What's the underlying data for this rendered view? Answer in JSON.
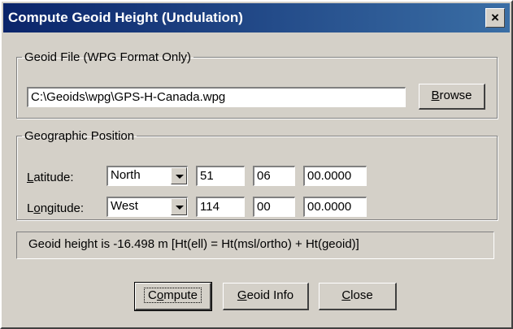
{
  "window": {
    "title": "Compute Geoid Height (Undulation)",
    "close_label": "×"
  },
  "geoid_file": {
    "legend": "Geoid File (WPG Format Only)",
    "path": "C:\\Geoids\\wpg\\GPS-H-Canada.wpg",
    "browse_rest": "rowse",
    "browse_accel": "B"
  },
  "geographic_position": {
    "legend": "Geographic Position",
    "latitude": {
      "label_accel": "L",
      "label_rest": "atitude:",
      "hemisphere": "North",
      "deg": "51",
      "min": "06",
      "sec": "00.0000"
    },
    "longitude": {
      "label_pre": "L",
      "label_accel": "o",
      "label_rest": "ngitude:",
      "hemisphere": "West",
      "deg": "114",
      "min": "00",
      "sec": "00.0000"
    }
  },
  "status_text": "Geoid height is -16.498 m  [Ht(ell) = Ht(msl/ortho) + Ht(geoid)]",
  "buttons": {
    "compute_pre": "C",
    "compute_accel": "o",
    "compute_rest": "mpute",
    "geoid_info_accel": "G",
    "geoid_info_rest": "eoid Info",
    "close_accel": "C",
    "close_rest": "lose"
  }
}
